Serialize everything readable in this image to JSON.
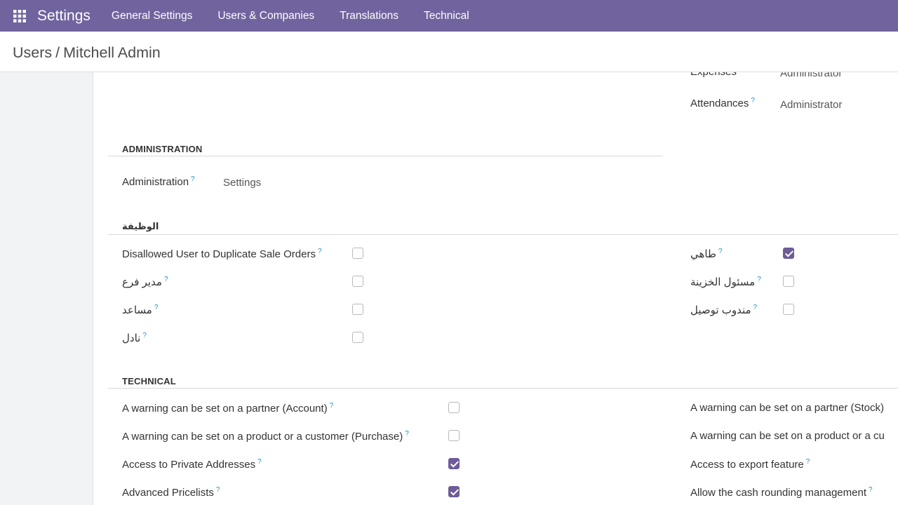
{
  "navbar": {
    "app_title": "Settings",
    "menu": [
      "General Settings",
      "Users & Companies",
      "Translations",
      "Technical"
    ]
  },
  "breadcrumb": {
    "parent": "Users",
    "separator": "/",
    "current": "Mitchell Admin"
  },
  "top_fields": [
    {
      "label": "Expenses",
      "value": "Administrator"
    },
    {
      "label": "Attendances",
      "value": "Administrator"
    }
  ],
  "administration": {
    "title": "ADMINISTRATION",
    "label": "Administration",
    "value": "Settings"
  },
  "job": {
    "title": "الوظيفة",
    "left": [
      {
        "label": "Disallowed User to Duplicate Sale Orders",
        "checked": false
      },
      {
        "label": "مدير فرع",
        "checked": false
      },
      {
        "label": "مساعد",
        "checked": false
      },
      {
        "label": "نادل",
        "checked": false
      }
    ],
    "right": [
      {
        "label": "طاهي",
        "checked": true
      },
      {
        "label": "مسئول الخزينة",
        "checked": false
      },
      {
        "label": "مندوب توصيل",
        "checked": false
      }
    ]
  },
  "technical": {
    "title": "TECHNICAL",
    "left": [
      {
        "label": "A warning can be set on a partner (Account)",
        "checked": false
      },
      {
        "label": "A warning can be set on a product or a customer (Purchase)",
        "checked": false
      },
      {
        "label": "Access to Private Addresses",
        "checked": true
      },
      {
        "label": "Advanced Pricelists",
        "checked": true
      }
    ],
    "right": [
      {
        "label": "A warning can be set on a partner (Stock)"
      },
      {
        "label": "A warning can be set on a product or a cu"
      },
      {
        "label": "Access to export feature"
      },
      {
        "label": "Allow the cash rounding management"
      }
    ]
  },
  "help_marker": "?",
  "colors": {
    "navbar": "#71639e",
    "checkbox_checked": "#6d5c97",
    "help": "#1f8ec4"
  }
}
